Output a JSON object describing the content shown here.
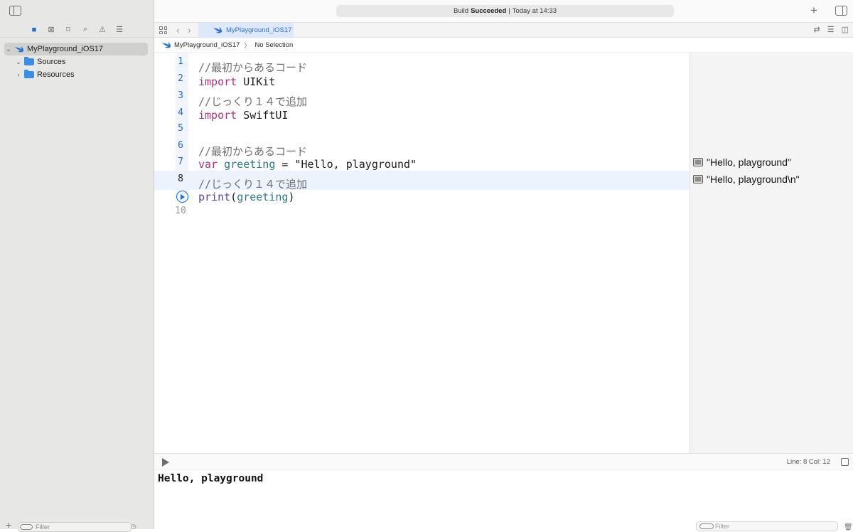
{
  "status": {
    "prefix": "Build",
    "result": "Succeeded",
    "separator": "|",
    "time": "Today at 14:33"
  },
  "sidebar": {
    "tree": [
      {
        "label": "MyPlayground_iOS17",
        "selected": true,
        "icon": "swift-icon"
      },
      {
        "label": "Sources",
        "icon": "folder-icon"
      },
      {
        "label": "Resources",
        "icon": "folder-icon"
      }
    ],
    "filter_placeholder": "Filter"
  },
  "tab": {
    "label": "MyPlayground_iOS17"
  },
  "breadcrumb": {
    "file": "MyPlayground_iOS17",
    "selection": "No Selection"
  },
  "code": {
    "numbers": [
      "1",
      "2",
      "3",
      "4",
      "5",
      "6",
      "7",
      "8",
      "10"
    ],
    "l1": "//最初からあるコード",
    "l2_kw": "import",
    "l2_rest": " UIKit",
    "l3": "//じっくり１４で追加",
    "l4_kw": "import",
    "l4_rest": " SwiftUI",
    "l6": "//最初からあるコード",
    "l7_kw": "var",
    "l7_name": " greeting",
    "l7_rest": " = \"Hello, playground\"",
    "l8": "//じっくり１４で追加",
    "l9_fn": "print",
    "l9_open": "(",
    "l9_arg": "greeting",
    "l9_close": ")"
  },
  "results": [
    "\"Hello, playground\"",
    "\"Hello, playground\\n\""
  ],
  "debug": {
    "line_col": "Line: 8  Col: 12"
  },
  "console": {
    "output": "Hello, playground",
    "filter_placeholder": "Filter"
  }
}
